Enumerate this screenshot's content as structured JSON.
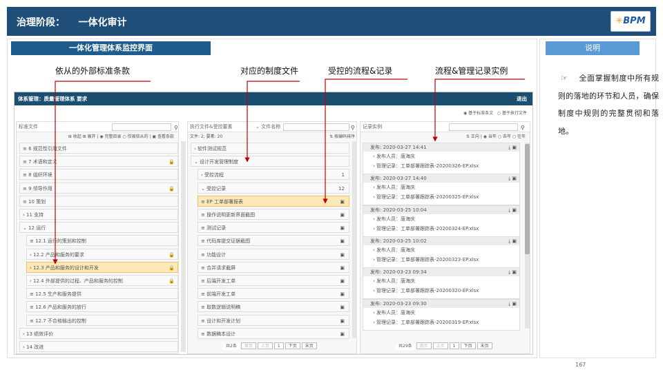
{
  "header": {
    "title": "治理阶段：    一体化审计",
    "logo_text": "BPM"
  },
  "left_title": "一体化管理体系监控界面",
  "right_title": "说明",
  "annotations": [
    "依从的外部标准条款",
    "对应的制度文件",
    "受控的流程&记录",
    "流程&管理记录实例"
  ],
  "description": "全面掌握制度中所有规则的落地的环节和人员，确保制度中规则的完整贯彻和落地。",
  "page_number": "167",
  "screen": {
    "title": "体系管理：质量管理体系 要求",
    "exit": "退出",
    "radio_std": "基于标准条文",
    "radio_exec": "基于执行文件",
    "col1": {
      "header": "标准文件",
      "opts": "⊞ 收起  ⊞ 展开 | ◉ 完整目录  ○ 仅被依从的 | ▣ 查看条款",
      "items": [
        {
          "label": "≡ 6 规范性引用文件",
          "lock": "",
          "hl": false
        },
        {
          "label": "≡ 7 术语和定义",
          "lock": "🔒",
          "hl": false
        },
        {
          "label": "≡ 8 组织环境",
          "lock": "",
          "hl": false
        },
        {
          "label": "≡ 9 领导作用",
          "lock": "🔒",
          "hl": false
        },
        {
          "label": "≡ 10 策划",
          "lock": "",
          "hl": false
        },
        {
          "label": "› 11 支持",
          "lock": "",
          "hl": false
        },
        {
          "label": "⌄ 12 运行",
          "lock": "",
          "hl": false
        },
        {
          "label": "≡ 12.1 运行的策划和控制",
          "lock": "",
          "hl": false
        },
        {
          "label": "› 12.2 产品和服务的要求",
          "lock": "🔒",
          "hl": false
        },
        {
          "label": "› 12.3 产品和服务的设计和开发",
          "lock": "🔒",
          "hl": true
        },
        {
          "label": "› 12.4 外部提供的过程、产品和服务的控制",
          "lock": "🔒",
          "hl": false
        },
        {
          "label": "≡ 12.5 生产和服务提供",
          "lock": "",
          "hl": false
        },
        {
          "label": "≡ 12.6 产品和服务的放行",
          "lock": "",
          "hl": false
        },
        {
          "label": "≡ 12.7 不合格输出的控制",
          "lock": "",
          "hl": false
        },
        {
          "label": "› 13 绩效评价",
          "lock": "",
          "hl": false
        },
        {
          "label": "› 14 改进",
          "lock": "",
          "hl": false
        }
      ]
    },
    "col2": {
      "header": "执行文件&受控要素",
      "header2": "⌄ 文件名称",
      "sub": "文件: 2; 要素: 20",
      "sort": "⇅ 按编码排序",
      "items": [
        {
          "label": "› 软件测试规范",
          "cnt": "",
          "hl": false
        },
        {
          "label": "⌄ 设计开发管理制度",
          "cnt": "",
          "hl": false
        },
        {
          "label": "› 受控流程",
          "cnt": "1",
          "hl": false
        },
        {
          "label": "⌄ 受控记录",
          "cnt": "12",
          "hl": false
        },
        {
          "label": "≡ EP 工单部署报表",
          "cnt": "▣",
          "hl": true
        },
        {
          "label": "≡ 操作说明更新界面截图",
          "cnt": "▣",
          "hl": false
        },
        {
          "label": "≡ 测试记录",
          "cnt": "▣",
          "hl": false
        },
        {
          "label": "≡ 代码库提交证据截图",
          "cnt": "▣",
          "hl": false
        },
        {
          "label": "≡ 功能设计",
          "cnt": "▣",
          "hl": false
        },
        {
          "label": "≡ 合并请求截屏",
          "cnt": "▣",
          "hl": false
        },
        {
          "label": "≡ 后端开发工单",
          "cnt": "▣",
          "hl": false
        },
        {
          "label": "≡ 前端开发工单",
          "cnt": "▣",
          "hl": false
        },
        {
          "label": "≡ 取数逻辑说明稿",
          "cnt": "▣",
          "hl": false
        },
        {
          "label": "≡ 设计和开发计划",
          "cnt": "▣",
          "hl": false
        },
        {
          "label": "≡ 数据稿本设计",
          "cnt": "▣",
          "hl": false
        }
      ],
      "pager": {
        "total": "共2条",
        "first": "首页",
        "prev": "上页",
        "page": "1",
        "next": "下页",
        "last": "末页"
      }
    },
    "col3": {
      "header": "记录实例",
      "opts": "⇅ 正向 | ◉ 当年  ○ 去年  ○ 往年",
      "records": [
        {
          "date": "发布: 2020-03-27 14:41",
          "person": "发布人员：唐海庆",
          "file": "管理记录：工单部署跟踪表-20200326-EP.xlsx"
        },
        {
          "date": "发布: 2020-03-27 14:40",
          "person": "发布人员：唐海庆",
          "file": "管理记录：工单部署跟踪表-20200325-EP.xlsx"
        },
        {
          "date": "发布: 2020-03-25 10:04",
          "person": "发布人员：唐海庆",
          "file": "管理记录：工单部署跟踪表-20200324-EP.xlsx"
        },
        {
          "date": "发布: 2020-03-25 10:02",
          "person": "发布人员：唐海庆",
          "file": "管理记录：工单部署跟踪表-20200323-EP.xlsx"
        },
        {
          "date": "发布: 2020-03-23 09:34",
          "person": "发布人员：唐海庆",
          "file": "管理记录：工单部署跟踪表-20200320-EP.xlsx"
        },
        {
          "date": "发布: 2020-03-23 09:30",
          "person": "发布人员：唐海庆",
          "file": "管理记录：工单部署跟踪表-20200319-EP.xlsx"
        }
      ],
      "pager": {
        "total": "共29条",
        "first": "首页",
        "prev": "上页",
        "page": "1",
        "next": "下页",
        "last": "末页"
      }
    }
  }
}
